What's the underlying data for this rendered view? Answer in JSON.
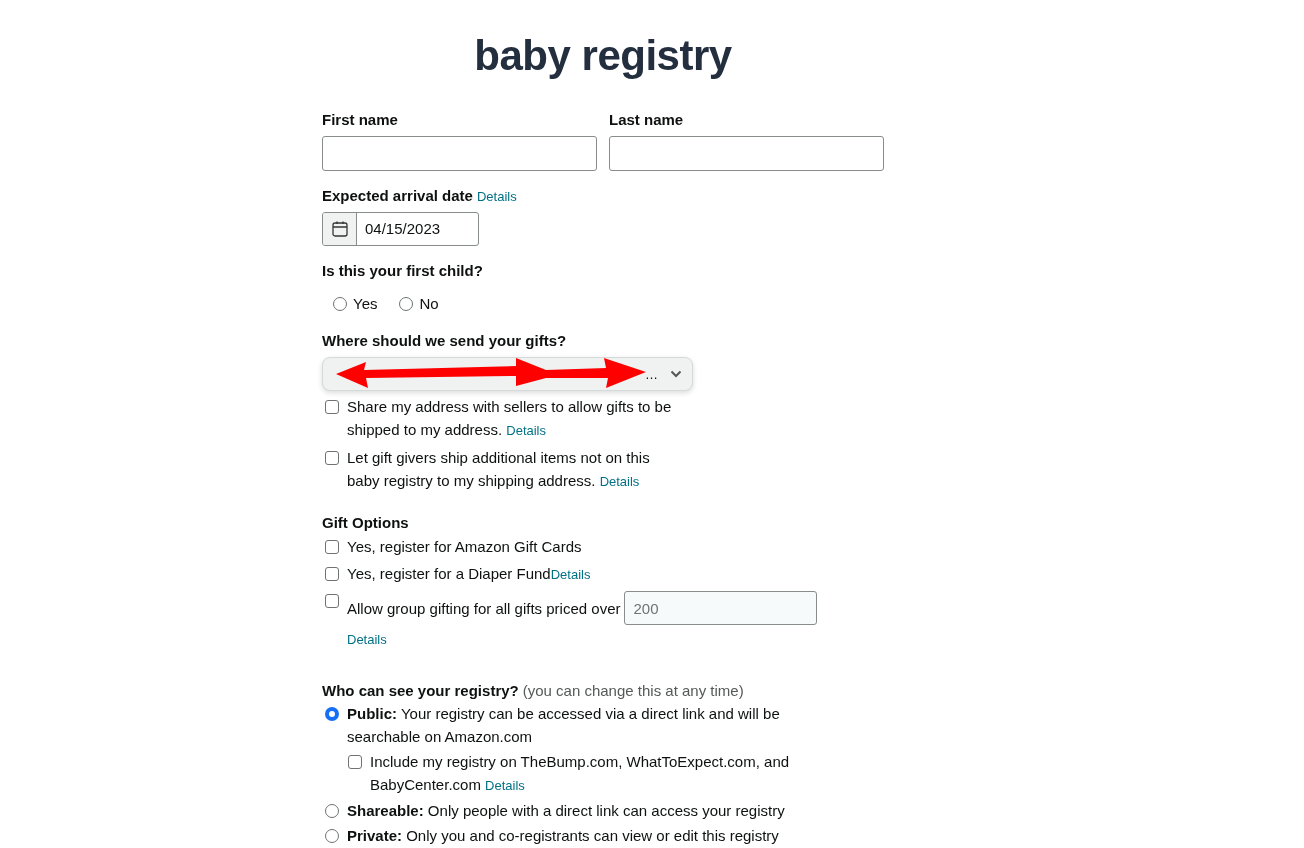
{
  "title": "baby registry",
  "name_fields": [
    {
      "label": "First name"
    },
    {
      "label": "Last name"
    }
  ],
  "arrival": {
    "label": "Expected arrival date",
    "link": "Details",
    "value": "04/15/2023"
  },
  "first_child": {
    "label": "Is this your first child?",
    "options": [
      {
        "label": "Yes",
        "selected": false
      },
      {
        "label": "No",
        "selected": false
      }
    ]
  },
  "shipping": {
    "label": "Where should we send your gifts?",
    "dropdown_value": "…",
    "options": [
      {
        "text": "Share my address with sellers to allow gifts to be shipped to my address.",
        "link": "Details",
        "checked": false
      },
      {
        "text": "Let gift givers ship additional items not on this baby registry to my shipping address.",
        "link": "Details",
        "checked": false
      }
    ]
  },
  "gift_options": {
    "heading": "Gift Options",
    "items": [
      {
        "kind": "plain",
        "text": "Yes, register for Amazon Gift Cards",
        "checked": false
      },
      {
        "kind": "link",
        "text": "Yes, register for a Diaper Fund",
        "link": "Details",
        "checked": false
      },
      {
        "kind": "amount",
        "text": "Allow group gifting for all gifts priced over",
        "placeholder": "200",
        "link": "Details",
        "checked": false
      }
    ]
  },
  "visibility": {
    "heading": "Who can see your registry?",
    "note": "(you can change this at any time)",
    "options": [
      {
        "text": "**Public:** Your registry can be accessed via a direct link and will be searchable on Amazon.com",
        "selected": true,
        "sub": {
          "text": "Include my registry on TheBump.com, WhatToExpect.com, and BabyCenter.com",
          "link": "Details",
          "checked": false
        }
      },
      {
        "text": "**Shareable:** Only people with a direct link can access your registry",
        "selected": false
      },
      {
        "text": "**Private:** Only you and co-registrants can view or edit this registry",
        "selected": false
      }
    ]
  }
}
